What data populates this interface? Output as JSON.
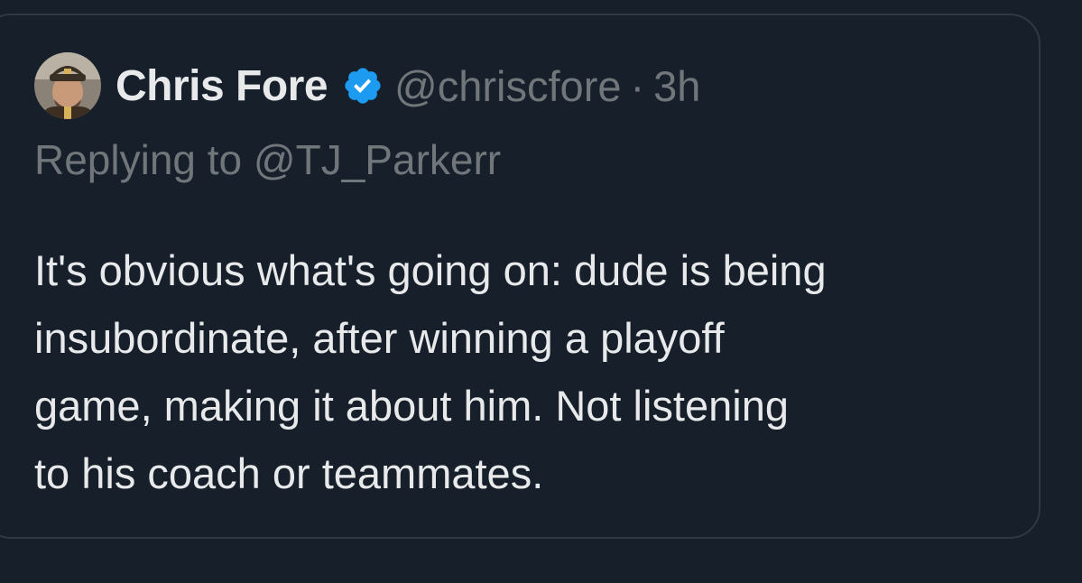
{
  "tweet": {
    "author": {
      "display_name": "Chris Fore",
      "handle": "@chriscfore",
      "avatar_icon": "user-avatar",
      "verified_icon": "verified-badge-icon",
      "verified_color": "#1d9bf0"
    },
    "separator": "·",
    "time": "3h",
    "reply_prefix": "Replying to",
    "reply_to": "@TJ_Parkerr",
    "body_lines": [
      "It's obvious what's going on: dude is being",
      "insubordinate, after winning a playoff",
      "game, making it about him. Not listening",
      "to his coach or teammates."
    ]
  },
  "colors": {
    "background": "#17202a",
    "primary_text": "#e7e9ea",
    "secondary_text": "#71767b",
    "border": "#2f3943"
  }
}
